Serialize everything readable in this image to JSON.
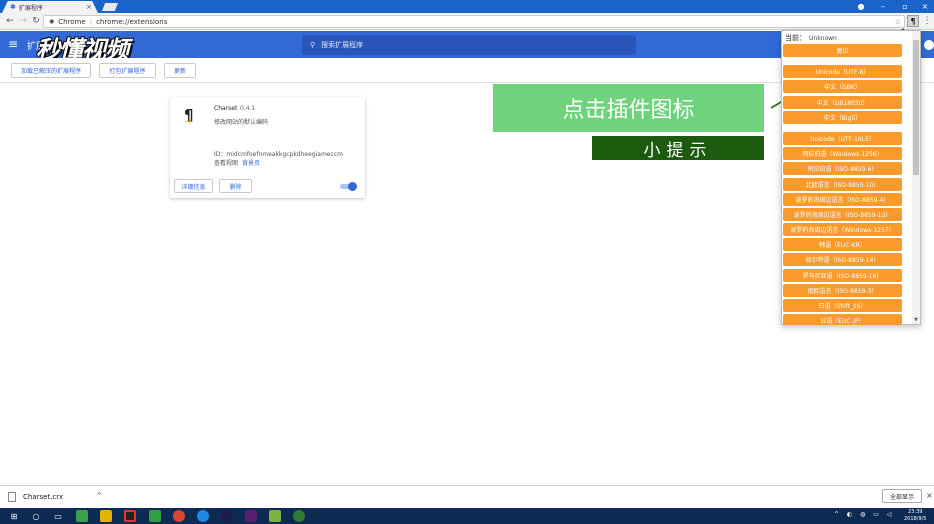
{
  "browser": {
    "tab_title": "扩展程序",
    "omnibox_scheme": "Chrome",
    "omnibox_url": "chrome://extensions"
  },
  "header": {
    "title": "扩展程序",
    "search_placeholder": "搜索扩展程序",
    "watermark": "秒懂视频"
  },
  "actions": {
    "load_unpacked": "加载已解压的扩展程序",
    "pack": "打包扩展程序",
    "update": "更新"
  },
  "extension_card": {
    "name": "Charset",
    "version": "0.4.1",
    "description": "修改网站的默认编码",
    "id_line": "ID：midcmfoefnmeakkgcpkdheegiameccm",
    "views_label": "查看视图",
    "views_link": "背景页",
    "details_button": "详细信息",
    "remove_button": "删除"
  },
  "overlays": {
    "tip_main": "点击插件图标",
    "tip_small": "小提示"
  },
  "charset_popup": {
    "current_label": "当前：",
    "current_value": "Unknown",
    "group1": [
      "复位"
    ],
    "group2": [
      "Unicode（UTF-8）",
      "中文（GBK）",
      "中文（GB18030）",
      "中文（Big5）"
    ],
    "group3": [
      "Unicode（UTF-16LE）",
      "阿拉伯语（Windows-1256）",
      "阿拉伯语（ISO-8859-6）",
      "北欧语言（ISO-8859-10）",
      "波罗的海周边语言（ISO-8859-4）",
      "波罗的海周边语言（ISO-8859-13）",
      "波罗的海周边语言（Windows-1257）",
      "韩语（EUC-KR）",
      "凯尔特语（ISO-8859-14）",
      "罗马尼亚语（ISO-8859-16）",
      "南欧语言（ISO-8859-3）",
      "日语（Shift_JIS）",
      "日语（EUC-JP）"
    ]
  },
  "downloads": {
    "file_name": "Charset.crx",
    "show_all": "全部显示"
  },
  "taskbar": {
    "time": "23:39",
    "date": "2018/9/5"
  }
}
